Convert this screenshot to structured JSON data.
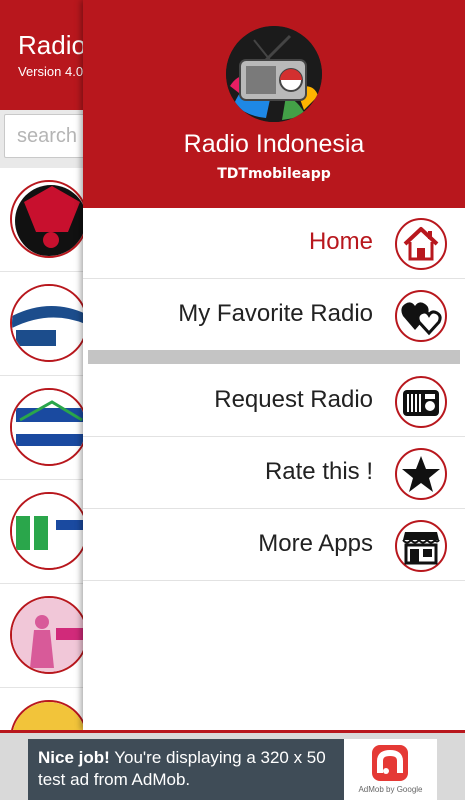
{
  "background_app": {
    "title": "Radio",
    "version": "Version 4.0",
    "search_placeholder": "search k"
  },
  "drawer": {
    "app_name": "Radio Indonesia",
    "developer": "TDTmobileapp",
    "menu": [
      {
        "label": "Home",
        "icon": "home-icon",
        "active": true
      },
      {
        "label": "My Favorite Radio",
        "icon": "hearts-icon",
        "active": false
      },
      {
        "label": "Request Radio",
        "icon": "radio-icon",
        "active": false
      },
      {
        "label": "Rate this !",
        "icon": "star-icon",
        "active": false
      },
      {
        "label": "More Apps",
        "icon": "store-icon",
        "active": false
      }
    ]
  },
  "ad": {
    "headline": "Nice job!",
    "body": "You're displaying a 320 x 50 test ad from AdMob.",
    "caption": "AdMob by Google"
  },
  "colors": {
    "accent": "#b8171d",
    "ad_bg": "#3f4c57"
  }
}
